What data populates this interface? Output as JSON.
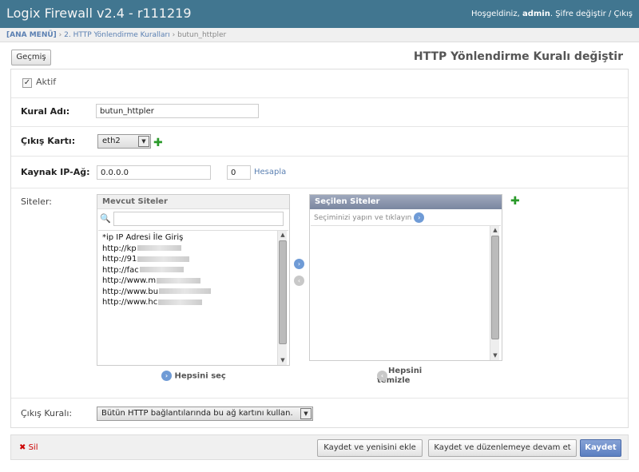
{
  "header": {
    "title": "Logix Firewall v2.4 - r111219",
    "welcome": "Hoşgeldiniz,",
    "username": "admin",
    "change_password": "Şifre değiştir",
    "separator": "/",
    "logout": "Çıkış"
  },
  "breadcrumbs": {
    "home": "[ANA MENÜ]",
    "sep": "›",
    "section": "2. HTTP Yönlendirme Kuralları",
    "current": "butun_httpler"
  },
  "page": {
    "history_button": "Geçmiş",
    "title": "HTTP Yönlendirme Kuralı değiştir"
  },
  "form": {
    "active_label": "Aktif",
    "active_checked": true,
    "active_check_glyph": "✓",
    "rule_name_label": "Kural Adı:",
    "rule_name_value": "butun_httpler",
    "out_card_label": "Çıkış Kartı:",
    "out_card_value": "eth2",
    "source_ip_label": "Kaynak IP-Ağ:",
    "source_ip_value": "0.0.0.0",
    "mask_value": "0",
    "calculate_link": "Hesapla",
    "sites_label": "Siteler:",
    "exit_rule_label": "Çıkış Kuralı:",
    "exit_rule_value": "Bütün HTTP bağlantılarında bu ağ kartını kullan."
  },
  "available_sites": {
    "title": "Mevcut Siteler",
    "search_value": "",
    "items": [
      "*ip IP Adresi İle Giriş",
      "http://kp",
      "http://91",
      "http://fac",
      "http://www.m",
      "http://www.bu",
      "http://www.hc"
    ],
    "choose_all": "Hepsini seç"
  },
  "chosen_sites": {
    "title": "Seçilen Siteler",
    "help": "Seçiminizi yapın ve tıklayın",
    "clear_all_line1": "Hepsini",
    "clear_all_line2": "temizle"
  },
  "footer": {
    "delete": "Sil",
    "delete_glyph": "✖",
    "save_and_add": "Kaydet ve yenisini ekle",
    "save_and_continue": "Kaydet ve düzenlemeye devam et",
    "save": "Kaydet"
  },
  "icons": {
    "plus_glyph": "✚",
    "search_glyph": "🔍",
    "arrow_right": "›",
    "arrow_left": "‹",
    "dropdown_arrow": "▼",
    "scroll_up": "▲",
    "scroll_down": "▼"
  },
  "colors": {
    "header_bg": "#417690",
    "link": "#5b80b2",
    "add_green": "#2a9a2a",
    "delete_red": "#cc0000",
    "save_blue": "#5b7fc1"
  }
}
